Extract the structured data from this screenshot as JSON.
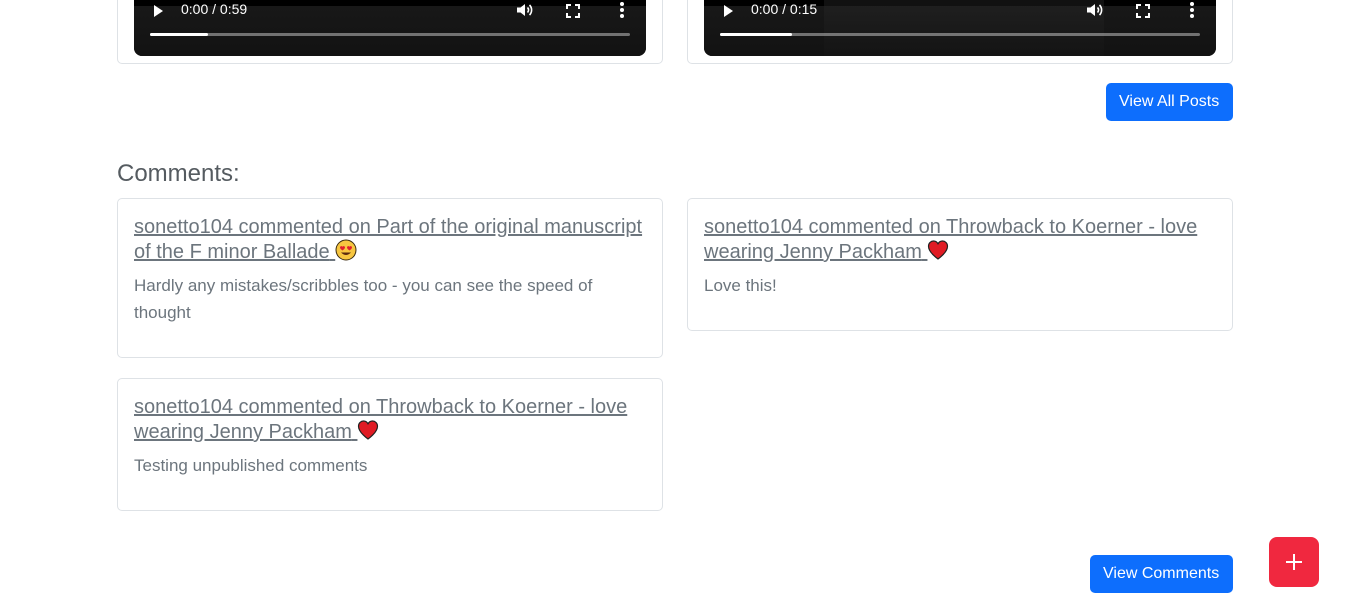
{
  "videos": [
    {
      "time": "0:00 / 0:59",
      "progress": 0.12
    },
    {
      "time": "0:00 / 0:15",
      "progress": 0.15
    }
  ],
  "buttons": {
    "view_all_posts": "View All Posts",
    "view_comments": "View Comments",
    "add": "+"
  },
  "comments_section": {
    "title": "Comments:",
    "items": [
      {
        "title": "sonetto104 commented on Part of the original manuscript of the F minor Ballade",
        "emoji": "heart-eyes",
        "body": "Hardly any mistakes/scribbles too - you can see the speed of thought"
      },
      {
        "title": "sonetto104 commented on Throwback to Koerner - love wearing Jenny Packham",
        "emoji": "red-heart",
        "body": "Love this!"
      },
      {
        "title": "sonetto104 commented on Throwback to Koerner - love wearing Jenny Packham",
        "emoji": "red-heart",
        "body": "Testing unpublished comments"
      }
    ]
  },
  "colors": {
    "primary": "#0d6efd",
    "fab": "#f0283f",
    "text_muted": "#6c757d"
  }
}
